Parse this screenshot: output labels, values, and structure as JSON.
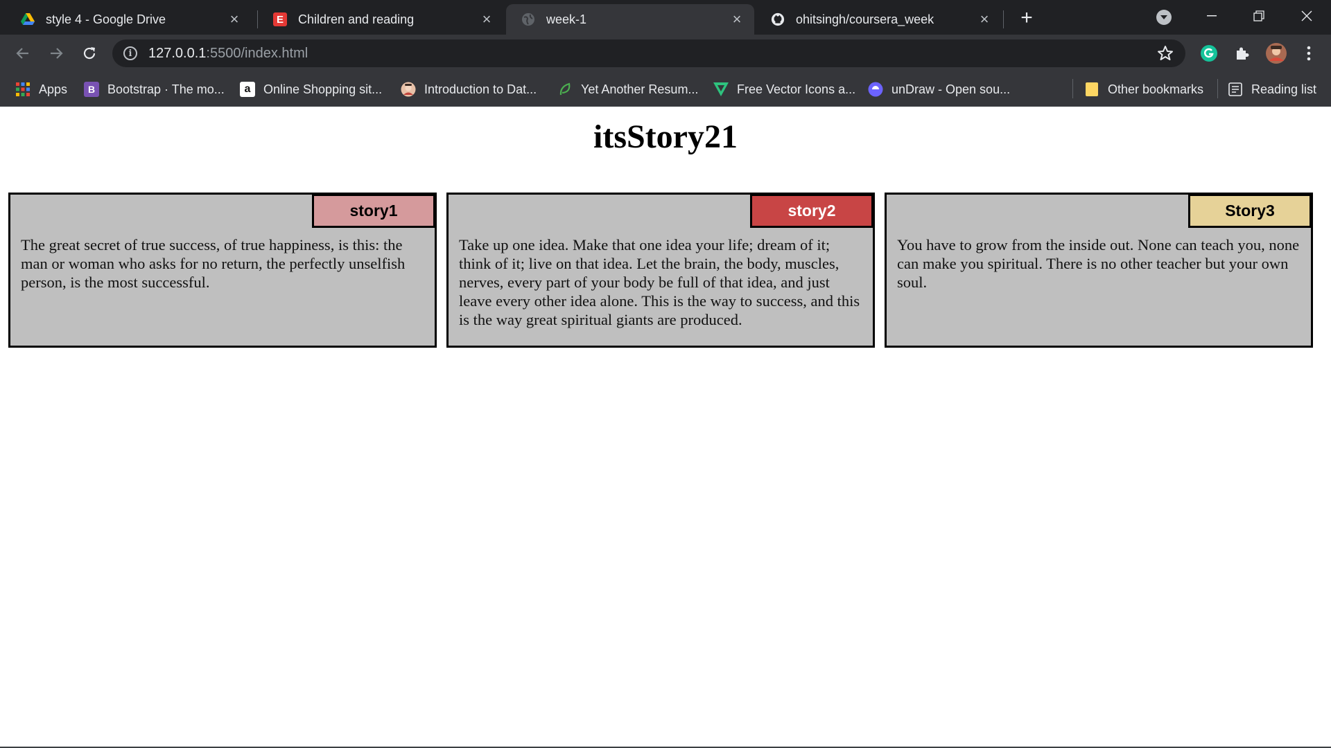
{
  "browser": {
    "tabs": [
      {
        "title": "style 4 - Google Drive",
        "icon": "google-drive-icon",
        "active": false
      },
      {
        "title": "Children and reading",
        "icon": "letter-e-icon",
        "active": false
      },
      {
        "title": "week-1",
        "icon": "globe-icon",
        "active": true
      },
      {
        "title": "ohitsingh/coursera_week",
        "icon": "github-icon",
        "active": false
      }
    ],
    "url_host": "127.0.0.1",
    "url_rest": ":5500/index.html",
    "bookmarks": [
      {
        "label": "Apps",
        "icon": "apps-grid-icon"
      },
      {
        "label": "Bootstrap · The mo...",
        "icon": "bootstrap-icon"
      },
      {
        "label": "Online Shopping sit...",
        "icon": "amazon-icon"
      },
      {
        "label": "Introduction to Dat...",
        "icon": "avatar-icon"
      },
      {
        "label": "Yet Another Resum...",
        "icon": "leaf-icon"
      },
      {
        "label": "Free Vector Icons a...",
        "icon": "vector-icon"
      },
      {
        "label": "unDraw - Open sou...",
        "icon": "undraw-icon"
      }
    ],
    "other_bookmarks": "Other bookmarks",
    "reading_list": "Reading list"
  },
  "page": {
    "title": "itsStory21",
    "stories": [
      {
        "label": "story1",
        "badge_color": "#d59a9c",
        "label_color": "#000000",
        "text": "The great secret of true success, of true happiness, is this: the man or woman who asks for no return, the perfectly unselfish person, is the most successful."
      },
      {
        "label": "story2",
        "badge_color": "#c84545",
        "label_color": "#ffffff",
        "text": "Take up one idea. Make that one idea your life; dream of it; think of it; live on that idea. Let the brain, the body, muscles, nerves, every part of your body be full of that idea, and just leave every other idea alone. This is the way to success, and this is the way great spiritual giants are produced."
      },
      {
        "label": "Story3",
        "badge_color": "#e6d298",
        "label_color": "#000000",
        "text": "You have to grow from the inside out. None can teach you, none can make you spiritual. There is no other teacher but your own soul."
      }
    ]
  }
}
